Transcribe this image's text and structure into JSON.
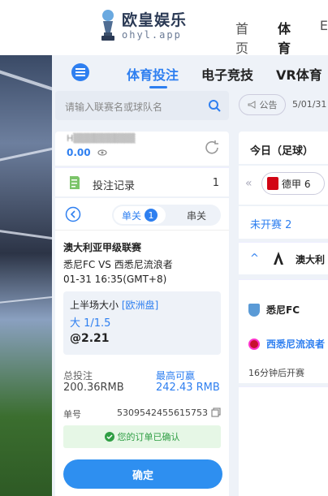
{
  "header": {
    "logo_cn": "欧皇娱乐",
    "logo_en": "ohyl.app",
    "nav": [
      "首页",
      "体育",
      "E"
    ]
  },
  "subnav": {
    "items": [
      "体育投注",
      "电子竞技",
      "VR体育"
    ],
    "active_index": 0
  },
  "search": {
    "placeholder": "请输入联赛名或球队名"
  },
  "account": {
    "name_masked": "H▒▒▒▒▒▒▒▒▒",
    "balance": "0.00"
  },
  "records": {
    "label": "投注记录",
    "count": "1"
  },
  "slip": {
    "tab_single": "单关",
    "tab_single_count": "1",
    "tab_parlay": "串关",
    "league": "澳大利亚甲级联赛",
    "teams": "悉尼FC VS 西悉尼流浪者",
    "match_time": "01-31 16:35(GMT+8)",
    "market": "上半场大小",
    "handicap_type": "[欧洲盘]",
    "selection": "大 1/1.5",
    "odds": "@2.21",
    "stake_label": "总投注",
    "stake_value": "200.36RMB",
    "win_label": "最高可赢",
    "win_value": "242.43 RMB",
    "order_label": "单号",
    "order_number": "5309542455615753",
    "confirmed_text": "您的订单已确认",
    "confirm_button": "确定"
  },
  "right": {
    "announce": "公告",
    "announce_date": "5/01/31",
    "today_tab": "今日（足球）",
    "league_chip": "德甲 6",
    "not_started": "未开赛 2",
    "league_name": "澳大利",
    "home_team": "悉尼FC",
    "away_team": "西悉尼流浪者",
    "kickoff": "16分钟后开赛"
  },
  "colors": {
    "accent": "#2e7ff0",
    "success": "#2f9e44",
    "panel_bg": "#eef2f8"
  }
}
